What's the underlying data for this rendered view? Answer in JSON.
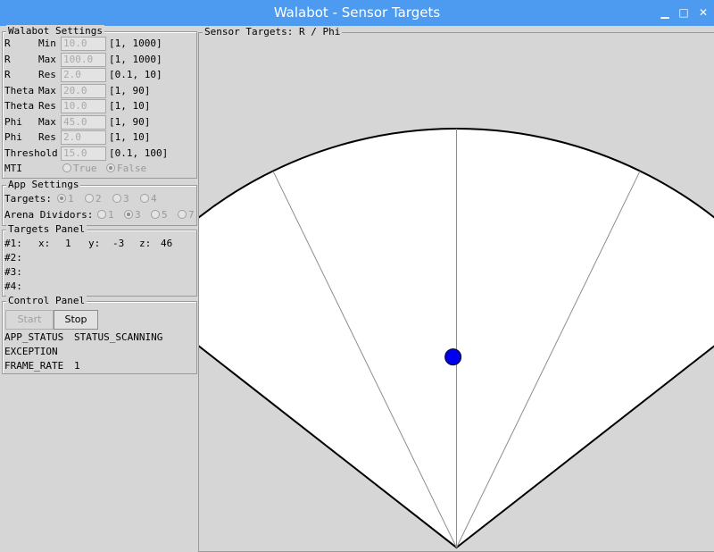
{
  "window": {
    "title": "Walabot - Sensor Targets"
  },
  "walabot_settings": {
    "title": "Walabot Settings",
    "rows": [
      {
        "name": "R",
        "param": "Min",
        "value": "10.0",
        "range": "[1, 1000]"
      },
      {
        "name": "R",
        "param": "Max",
        "value": "100.0",
        "range": "[1, 1000]"
      },
      {
        "name": "R",
        "param": "Res",
        "value": "2.0",
        "range": "[0.1, 10]"
      },
      {
        "name": "Theta",
        "param": "Max",
        "value": "20.0",
        "range": "[1, 90]"
      },
      {
        "name": "Theta",
        "param": "Res",
        "value": "10.0",
        "range": "[1, 10]"
      },
      {
        "name": "Phi",
        "param": "Max",
        "value": "45.0",
        "range": "[1, 90]"
      },
      {
        "name": "Phi",
        "param": "Res",
        "value": "2.0",
        "range": "[1, 10]"
      },
      {
        "name": "Threshold",
        "param": "",
        "value": "15.0",
        "range": "[0.1, 100]"
      }
    ],
    "mti": {
      "label": "MTI",
      "options": [
        "True",
        "False"
      ],
      "selected": "False"
    }
  },
  "app_settings": {
    "title": "App Settings",
    "targets": {
      "label": "Targets:",
      "options": [
        "1",
        "2",
        "3",
        "4"
      ],
      "selected": "1"
    },
    "arena": {
      "label": "Arena Dividors:",
      "options": [
        "1",
        "3",
        "5",
        "7"
      ],
      "selected": "3"
    }
  },
  "targets_panel": {
    "title": "Targets Panel",
    "rows": [
      {
        "id": "#1:",
        "x_label": "x:",
        "x": "1",
        "y_label": "y:",
        "y": "-3",
        "z_label": "z:",
        "z": "46"
      },
      {
        "id": "#2:"
      },
      {
        "id": "#3:"
      },
      {
        "id": "#4:"
      }
    ]
  },
  "control_panel": {
    "title": "Control Panel",
    "start_label": "Start",
    "stop_label": "Stop",
    "status": [
      {
        "key": "APP_STATUS",
        "value": "STATUS_SCANNING"
      },
      {
        "key": "EXCEPTION",
        "value": ""
      },
      {
        "key": "FRAME_RATE",
        "value": "1"
      }
    ]
  },
  "sensor": {
    "title": "Sensor Targets: R / Phi",
    "dividers": 3,
    "fill": "#ffffff",
    "target_color": "#0000ee",
    "target": {
      "r_fraction": 0.455,
      "phi_fraction": -0.02
    }
  },
  "icons": [
    "minimize-icon",
    "maximize-icon",
    "close-icon"
  ]
}
